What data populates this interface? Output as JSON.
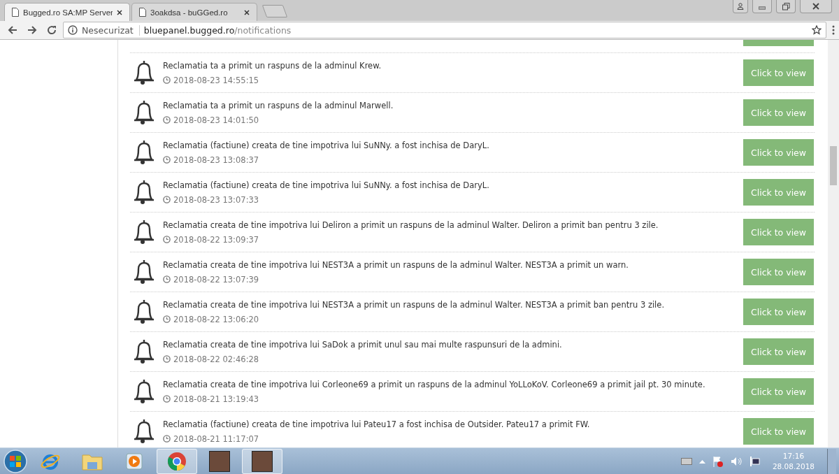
{
  "browser": {
    "tabs": [
      {
        "title": "Bugged.ro SA:MP Server",
        "selected": true
      },
      {
        "title": "3oakdsa - buGGed.ro",
        "selected": false
      }
    ],
    "address": {
      "security": "Nesecurizat",
      "host": "bluepanel.bugged.ro",
      "path": "/notifications"
    }
  },
  "notifications": [
    {
      "message": "Reclamatia ta a primit un raspuns de la adminul Krew.",
      "time": "2018-08-23 14:55:15",
      "button": "Click to view"
    },
    {
      "message": "Reclamatia ta a primit un raspuns de la adminul Marwell.",
      "time": "2018-08-23 14:01:50",
      "button": "Click to view"
    },
    {
      "message": "Reclamatia (factiune) creata de tine impotriva lui SuNNy. a fost inchisa de DaryL.",
      "time": "2018-08-23 13:08:37",
      "button": "Click to view"
    },
    {
      "message": "Reclamatia (factiune) creata de tine impotriva lui SuNNy. a fost inchisa de DaryL.",
      "time": "2018-08-23 13:07:33",
      "button": "Click to view"
    },
    {
      "message": "Reclamatia creata de tine impotriva lui Deliron a primit un raspuns de la adminul Walter. Deliron a primit ban pentru 3 zile.",
      "time": "2018-08-22 13:09:37",
      "button": "Click to view"
    },
    {
      "message": "Reclamatia creata de tine impotriva lui NEST3A a primit un raspuns de la adminul Walter. NEST3A a primit un warn.",
      "time": "2018-08-22 13:07:39",
      "button": "Click to view"
    },
    {
      "message": "Reclamatia creata de tine impotriva lui NEST3A a primit un raspuns de la adminul Walter. NEST3A a primit ban pentru 3 zile.",
      "time": "2018-08-22 13:06:20",
      "button": "Click to view"
    },
    {
      "message": "Reclamatia creata de tine impotriva lui SaDok a primit unul sau mai multe raspunsuri de la admini.",
      "time": "2018-08-22 02:46:28",
      "button": "Click to view"
    },
    {
      "message": "Reclamatia creata de tine impotriva lui Corleone69 a primit un raspuns de la adminul YoLLoKoV. Corleone69 a primit jail pt. 30 minute.",
      "time": "2018-08-21 13:19:43",
      "button": "Click to view"
    },
    {
      "message": "Reclamatia (factiune) creata de tine impotriva lui Pateu17 a fost inchisa de Outsider. Pateu17 a primit FW.",
      "time": "2018-08-21 11:17:07",
      "button": "Click to view"
    }
  ],
  "taskbar": {
    "apps": [
      {
        "kind": "ie",
        "active": false
      },
      {
        "kind": "explorer",
        "active": false
      },
      {
        "kind": "media",
        "active": false
      },
      {
        "kind": "chrome",
        "active": true
      },
      {
        "kind": "photo",
        "active": false
      },
      {
        "kind": "photo",
        "active": true
      }
    ],
    "clock": {
      "time": "17:16",
      "date": "28.08.2018"
    }
  }
}
